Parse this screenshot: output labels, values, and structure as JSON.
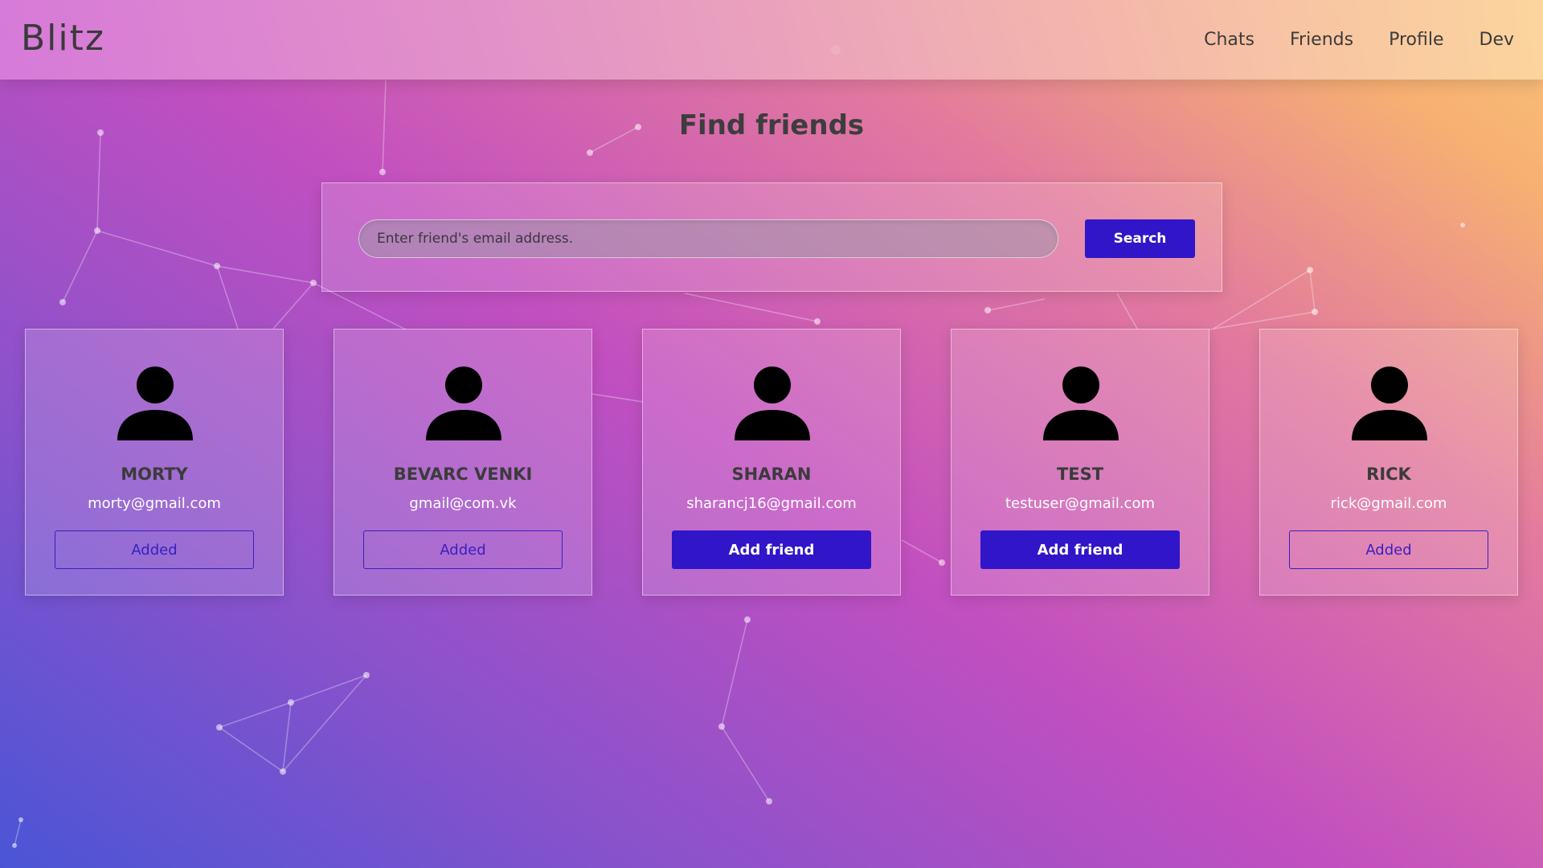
{
  "app": {
    "logo": "Blitz"
  },
  "nav": {
    "items": [
      {
        "label": "Chats"
      },
      {
        "label": "Friends"
      },
      {
        "label": "Profile"
      },
      {
        "label": "Dev"
      }
    ]
  },
  "main": {
    "title": "Find friends",
    "search": {
      "placeholder": "Enter friend's email address.",
      "value": "",
      "button_label": "Search"
    },
    "users": [
      {
        "name": "MORTY",
        "email": "morty@gmail.com",
        "action": "Added",
        "status": "added"
      },
      {
        "name": "BEVARC VENKI",
        "email": "gmail@com.vk",
        "action": "Added",
        "status": "added"
      },
      {
        "name": "SHARAN",
        "email": "sharancj16@gmail.com",
        "action": "Add friend",
        "status": "not-added"
      },
      {
        "name": "TEST",
        "email": "testuser@gmail.com",
        "action": "Add friend",
        "status": "not-added"
      },
      {
        "name": "RICK",
        "email": "rick@gmail.com",
        "action": "Added",
        "status": "added"
      }
    ]
  },
  "colors": {
    "accent": "#3115c8",
    "added_outline": "#3a1fbf",
    "text_dark": "#3b3b3b"
  },
  "icons": {
    "avatar": "user-silhouette-icon"
  }
}
